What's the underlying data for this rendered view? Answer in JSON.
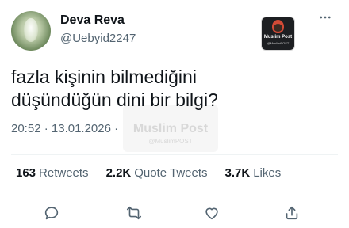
{
  "author": {
    "display_name": "Deva Reva",
    "handle": "@Uebyid2247",
    "avatar_icon": "profile-avatar"
  },
  "brand_badge": {
    "name": "Muslim Post",
    "sub": "@MuslimPOST"
  },
  "tweet": {
    "line1": "fazla kişinin bilmediğini",
    "line2": "düşündüğün dini bir bilgi?"
  },
  "meta": {
    "time": "20:52",
    "separator": "·",
    "date": "13.01.2026",
    "trailing": "·"
  },
  "watermark": {
    "name": "Muslim Post",
    "sub": "@MuslimPOST"
  },
  "stats": {
    "retweets_count": "163",
    "retweets_label": "Retweets",
    "quotes_count": "2.2K",
    "quotes_label": "Quote Tweets",
    "likes_count": "3.7K",
    "likes_label": "Likes"
  },
  "actions": [
    "reply-icon",
    "retweet-icon",
    "like-icon",
    "share-icon"
  ],
  "colors": {
    "text_primary": "#0f1419",
    "text_secondary": "#536471",
    "divider": "#eff3f4"
  }
}
